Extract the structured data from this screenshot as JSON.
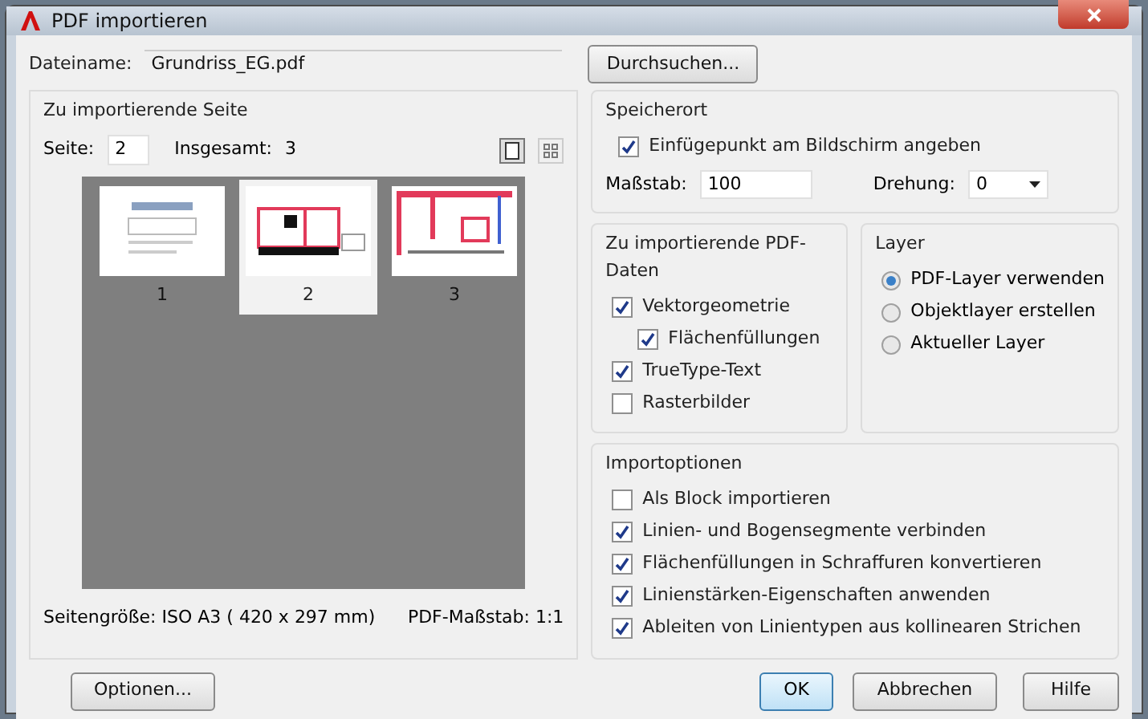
{
  "window": {
    "title": "PDF importieren"
  },
  "file": {
    "label": "Dateiname:",
    "value": "Grundriss_EG.pdf",
    "browse": "Durchsuchen..."
  },
  "page_panel": {
    "title": "Zu importierende Seite",
    "page_label": "Seite:",
    "page_value": "2",
    "total_label": "Insgesamt:",
    "total_value": "3",
    "view_modes": [
      {
        "kind": "single",
        "selected": true
      },
      {
        "kind": "grid",
        "selected": false
      }
    ],
    "pages": [
      {
        "label": "1",
        "selected": false
      },
      {
        "label": "2",
        "selected": true
      },
      {
        "label": "3",
        "selected": false
      }
    ],
    "page_size": "Seitengröße: ISO A3 ( 420 x  297 mm)",
    "pdf_scale": "PDF-Maßstab: 1:1"
  },
  "location": {
    "title": "Speicherort",
    "specify_on_screen": {
      "label": "Einfügepunkt am Bildschirm angeben",
      "checked": true
    },
    "scale_label": "Maßstab:",
    "scale_value": "100",
    "rotation_label": "Drehung:",
    "rotation_value": "0"
  },
  "pdf_data": {
    "title": "Zu importierende PDF-Daten",
    "items": [
      {
        "label": "Vektorgeometrie",
        "checked": true,
        "children": [
          {
            "label": "Flächenfüllungen",
            "checked": true
          }
        ]
      },
      {
        "label": "TrueType-Text",
        "checked": true
      },
      {
        "label": "Rasterbilder",
        "checked": false
      }
    ]
  },
  "layer": {
    "title": "Layer",
    "options": [
      {
        "label": "PDF-Layer verwenden",
        "selected": true
      },
      {
        "label": "Objektlayer erstellen",
        "selected": false
      },
      {
        "label": "Aktueller Layer",
        "selected": false
      }
    ]
  },
  "import_options": {
    "title": "Importoptionen",
    "items": [
      {
        "label": "Als Block importieren",
        "checked": false
      },
      {
        "label": "Linien- und Bogensegmente verbinden",
        "checked": true
      },
      {
        "label": "Flächenfüllungen in Schraffuren konvertieren",
        "checked": true
      },
      {
        "label": "Linienstärken-Eigenschaften anwenden",
        "checked": true
      },
      {
        "label": "Ableiten von Linientypen aus kollinearen Strichen",
        "checked": true
      }
    ]
  },
  "buttons": {
    "options": "Optionen...",
    "ok": "OK",
    "cancel": "Abbrechen",
    "help": "Hilfe"
  }
}
